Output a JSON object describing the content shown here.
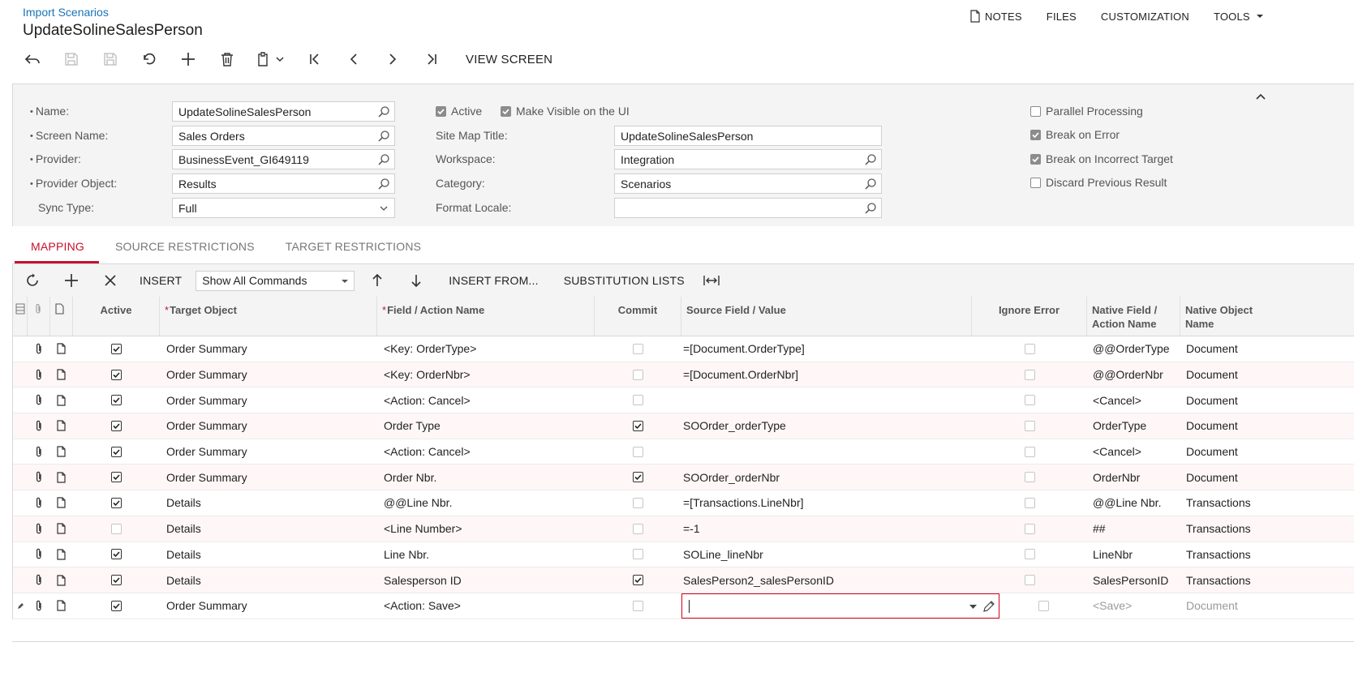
{
  "header": {
    "breadcrumb": "Import Scenarios",
    "title": "UpdateSolineSalesPerson",
    "nav": {
      "notes": "NOTES",
      "files": "FILES",
      "customization": "CUSTOMIZATION",
      "tools": "TOOLS"
    }
  },
  "toolbar": {
    "view_screen": "VIEW SCREEN"
  },
  "form": {
    "name_label": "Name:",
    "name_value": "UpdateSolineSalesPerson",
    "screen_name_label": "Screen Name:",
    "screen_name_value": "Sales Orders",
    "provider_label": "Provider:",
    "provider_value": "BusinessEvent_GI649119",
    "provider_object_label": "Provider Object:",
    "provider_object_value": "Results",
    "sync_type_label": "Sync Type:",
    "sync_type_value": "Full",
    "active_label": "Active",
    "active_checked": true,
    "visible_label": "Make Visible on the UI",
    "visible_checked": true,
    "site_map_title_label": "Site Map Title:",
    "site_map_title_value": "UpdateSolineSalesPerson",
    "workspace_label": "Workspace:",
    "workspace_value": "Integration",
    "category_label": "Category:",
    "category_value": "Scenarios",
    "format_locale_label": "Format Locale:",
    "format_locale_value": "",
    "parallel_label": "Parallel Processing",
    "parallel_checked": false,
    "break_error_label": "Break on Error",
    "break_error_checked": true,
    "break_target_label": "Break on Incorrect Target",
    "break_target_checked": true,
    "discard_label": "Discard Previous Result",
    "discard_checked": false
  },
  "tabs": [
    "MAPPING",
    "SOURCE RESTRICTIONS",
    "TARGET RESTRICTIONS"
  ],
  "grid_toolbar": {
    "insert": "INSERT",
    "commands_select": "Show All Commands",
    "insert_from": "INSERT FROM...",
    "substitution_lists": "SUBSTITUTION LISTS"
  },
  "grid": {
    "columns": {
      "active": "Active",
      "target_object": "Target Object",
      "field_action": "Field / Action Name",
      "commit": "Commit",
      "source_field": "Source Field / Value",
      "ignore_error": "Ignore Error",
      "native_field": "Native Field / Action Name",
      "native_object": "Native Object Name"
    },
    "rows": [
      {
        "active": true,
        "target": "Order Summary",
        "field": "<Key: OrderType>",
        "commit": false,
        "source": "=[Document.OrderType]",
        "ignore": false,
        "native_field": "@@OrderType",
        "native_object": "Document"
      },
      {
        "active": true,
        "target": "Order Summary",
        "field": "<Key: OrderNbr>",
        "commit": false,
        "source": "=[Document.OrderNbr]",
        "ignore": false,
        "native_field": "@@OrderNbr",
        "native_object": "Document"
      },
      {
        "active": true,
        "target": "Order Summary",
        "field": "<Action: Cancel>",
        "commit": false,
        "source": "",
        "ignore": false,
        "native_field": "<Cancel>",
        "native_object": "Document"
      },
      {
        "active": true,
        "target": "Order Summary",
        "field": "Order Type",
        "commit": true,
        "source": "SOOrder_orderType",
        "ignore": false,
        "native_field": "OrderType",
        "native_object": "Document"
      },
      {
        "active": true,
        "target": "Order Summary",
        "field": "<Action: Cancel>",
        "commit": false,
        "source": "",
        "ignore": false,
        "native_field": "<Cancel>",
        "native_object": "Document"
      },
      {
        "active": true,
        "target": "Order Summary",
        "field": "Order Nbr.",
        "commit": true,
        "source": "SOOrder_orderNbr",
        "ignore": false,
        "native_field": "OrderNbr",
        "native_object": "Document"
      },
      {
        "active": true,
        "target": "Details",
        "field": "@@Line Nbr.",
        "commit": false,
        "source": "=[Transactions.LineNbr]",
        "ignore": false,
        "native_field": "@@Line Nbr.",
        "native_object": "Transactions"
      },
      {
        "active": false,
        "target": "Details",
        "field": "<Line Number>",
        "commit": false,
        "source": "=-1",
        "ignore": false,
        "native_field": "##",
        "native_object": "Transactions"
      },
      {
        "active": true,
        "target": "Details",
        "field": "Line Nbr.",
        "commit": false,
        "source": "SOLine_lineNbr",
        "ignore": false,
        "native_field": "LineNbr",
        "native_object": "Transactions"
      },
      {
        "active": true,
        "target": "Details",
        "field": "Salesperson ID",
        "commit": true,
        "source": "SalesPerson2_salesPersonID",
        "ignore": false,
        "native_field": "SalesPersonID",
        "native_object": "Transactions"
      },
      {
        "active": true,
        "target": "Order Summary",
        "field": "<Action: Save>",
        "commit": false,
        "source": "",
        "ignore": false,
        "native_field": "<Save>",
        "native_object": "Document",
        "editing": true
      }
    ]
  }
}
